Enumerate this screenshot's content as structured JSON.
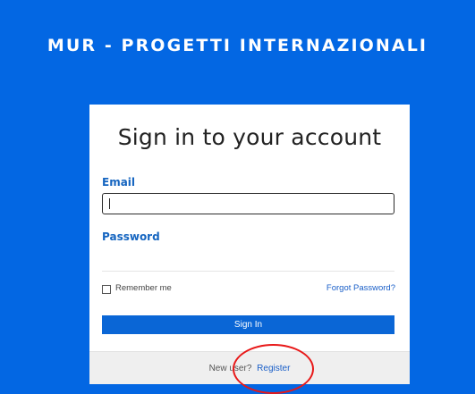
{
  "header": {
    "title": "MUR - PROGETTI INTERNAZIONALI"
  },
  "login": {
    "heading": "Sign in to your account",
    "email_label": "Email",
    "email_value": "",
    "password_label": "Password",
    "password_value": "",
    "remember_label": "Remember me",
    "forgot_label": "Forgot Password?",
    "signin_label": "Sign In"
  },
  "register": {
    "prompt": "New user?",
    "link_label": "Register"
  },
  "colors": {
    "background": "#0367e3",
    "primary_button": "#0a66d6",
    "link": "#1a5fc8",
    "annotation": "#e81818"
  }
}
